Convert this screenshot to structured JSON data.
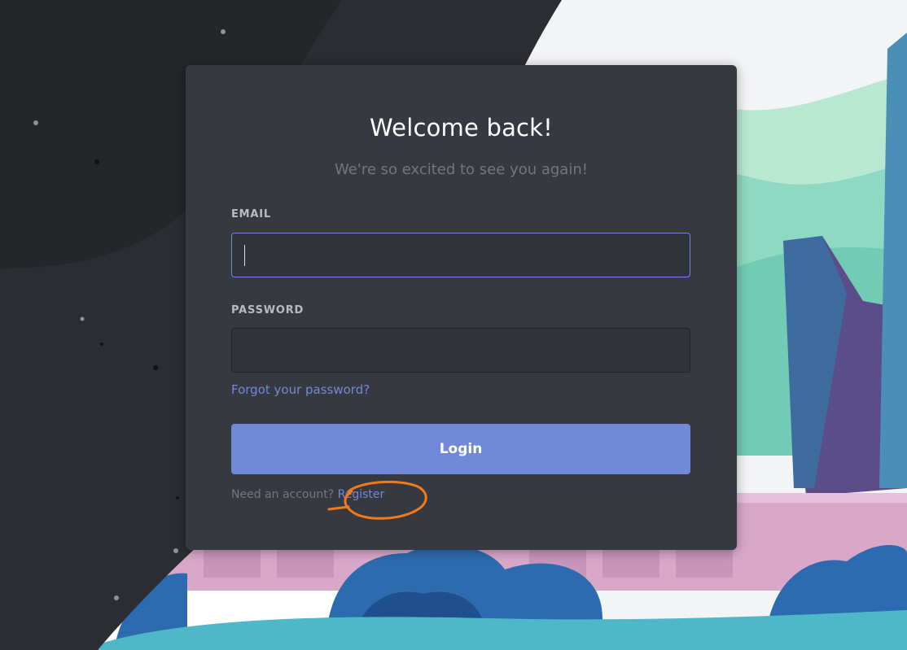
{
  "login": {
    "title": "Welcome back!",
    "subtitle": "We're so excited to see you again!",
    "email_label": "EMAIL",
    "email_value": "",
    "password_label": "PASSWORD",
    "password_value": "",
    "forgot_link": "Forgot your password?",
    "login_button": "Login",
    "need_account_text": "Need an account?",
    "register_link": "Register"
  },
  "colors": {
    "card_background": "#36393f",
    "accent": "#7289da",
    "input_background": "#303339",
    "muted_text": "#72767d",
    "annotation_stroke": "#f07a1c"
  },
  "annotation": {
    "shape": "hand-drawn-circle",
    "target": "register-link"
  }
}
